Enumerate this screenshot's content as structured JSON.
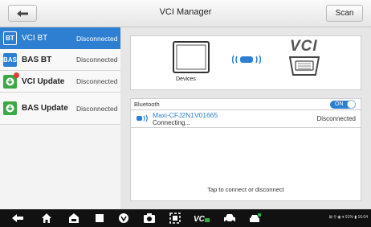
{
  "header": {
    "title": "VCI Manager",
    "scan_label": "Scan"
  },
  "sidebar": {
    "items": [
      {
        "icon_text": "BT",
        "label": "VCI BT",
        "status": "Disconnected"
      },
      {
        "icon_text": "BAS",
        "label": "BAS BT",
        "status": "Disconnected"
      },
      {
        "icon_text": "",
        "label": "VCI Update",
        "status": "Disconnected"
      },
      {
        "icon_text": "",
        "label": "BAS Update",
        "status": "Disconnected"
      }
    ]
  },
  "devices": {
    "label": "Devices",
    "vci_logo": "VCI"
  },
  "bluetooth": {
    "title": "Bluetooth",
    "toggle": "ON",
    "device_name": "Maxi-CFJ2N1V01665",
    "device_sub": "Connecting...",
    "device_status": "Disconnected",
    "hint": "Tap to connect or disconnect"
  },
  "statusbar": {
    "text": "⊠ ⚲ ◉ ▾ 91% ▮ 16:04"
  },
  "colors": {
    "accent": "#2e7fd2",
    "update_green": "#3aa845",
    "badge_red": "#e53935"
  }
}
